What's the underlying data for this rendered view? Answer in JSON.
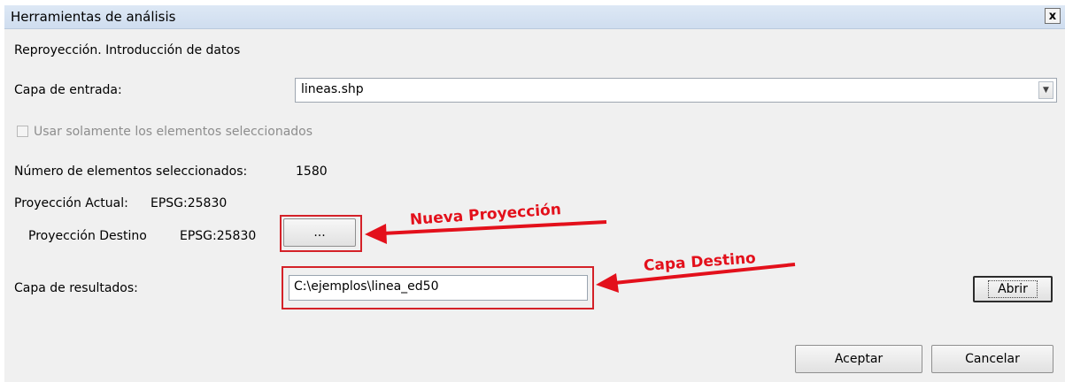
{
  "window": {
    "title": "Herramientas de análisis",
    "close_label": "x"
  },
  "section_title": "Reproyección. Introducción de datos",
  "input_layer": {
    "label": "Capa de entrada:",
    "value": "lineas.shp"
  },
  "selection_only": {
    "label": "Usar solamente los elementos seleccionados",
    "checked": false,
    "enabled": false
  },
  "selected_count": {
    "label": "Número de elementos seleccionados:",
    "value": "1580"
  },
  "current_projection": {
    "label": "Proyección Actual:",
    "value": "EPSG:25830"
  },
  "target_projection": {
    "label": "Proyección Destino",
    "value": "EPSG:25830",
    "button_label": "..."
  },
  "output_layer": {
    "label": "Capa de resultados:",
    "value": "C:\\ejemplos\\linea_ed50",
    "open_button": "Abrir"
  },
  "buttons": {
    "accept": "Aceptar",
    "cancel": "Cancelar"
  },
  "annotations": {
    "new_projection": "Nueva Proyección",
    "target_layer": "Capa Destino",
    "color": "#e3101b"
  },
  "icons": {
    "combo_arrow": "chevron-down-icon",
    "close": "close-icon"
  }
}
